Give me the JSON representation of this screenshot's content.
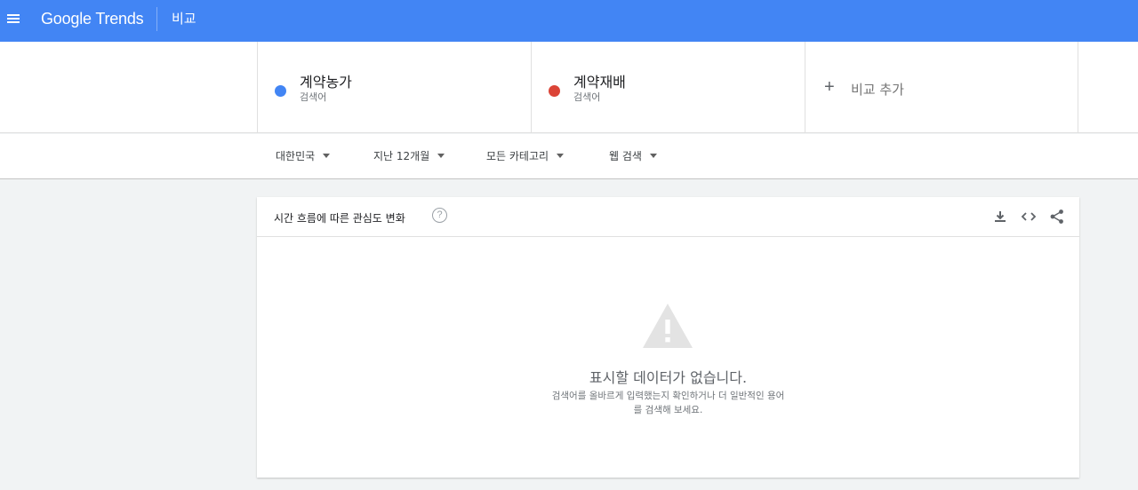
{
  "header": {
    "logo": "Google Trends",
    "title": "비교"
  },
  "terms": [
    {
      "name": "계약농가",
      "type": "검색어",
      "color": "#4285f4"
    },
    {
      "name": "계약재배",
      "type": "검색어",
      "color": "#db4437"
    }
  ],
  "add_compare": {
    "icon": "+",
    "label": "비교 추가"
  },
  "filters": {
    "region": "대한민국",
    "time": "지난 12개월",
    "category": "모든 카테고리",
    "search_type": "웹 검색"
  },
  "card": {
    "title": "시간 흐름에 따른 관심도 변화",
    "help_icon": "?",
    "empty_title": "표시할 데이터가 없습니다.",
    "empty_desc": "검색어를 올바르게 입력했는지 확인하거나 더 일반적인 용어를 검색해 보세요."
  },
  "colors": {
    "header": "#4285f4",
    "term1": "#4285f4",
    "term2": "#db4437"
  }
}
